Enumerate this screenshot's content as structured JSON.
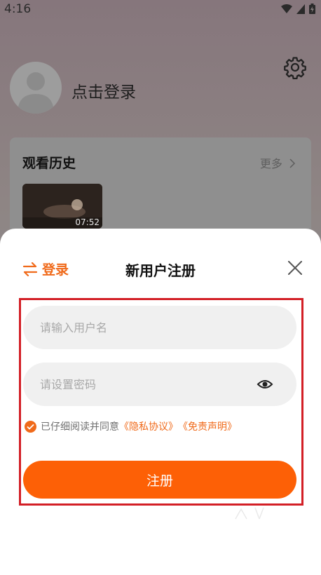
{
  "status": {
    "time": "4:16"
  },
  "profile": {
    "login_prompt": "点击登录"
  },
  "history": {
    "title": "观看历史",
    "more": "更多",
    "items": [
      {
        "duration": "07:52"
      }
    ]
  },
  "sheet": {
    "switch_login": "登录",
    "title": "新用户注册",
    "username_placeholder": "请输入用户名",
    "password_placeholder": "请设置密码",
    "agree_text": "已仔细阅读并同意",
    "privacy_link": "《隐私协议》",
    "disclaimer_link": "《免责声明》",
    "submit": "注册"
  },
  "colors": {
    "accent": "#fd6006",
    "highlight": "#d31f26"
  }
}
